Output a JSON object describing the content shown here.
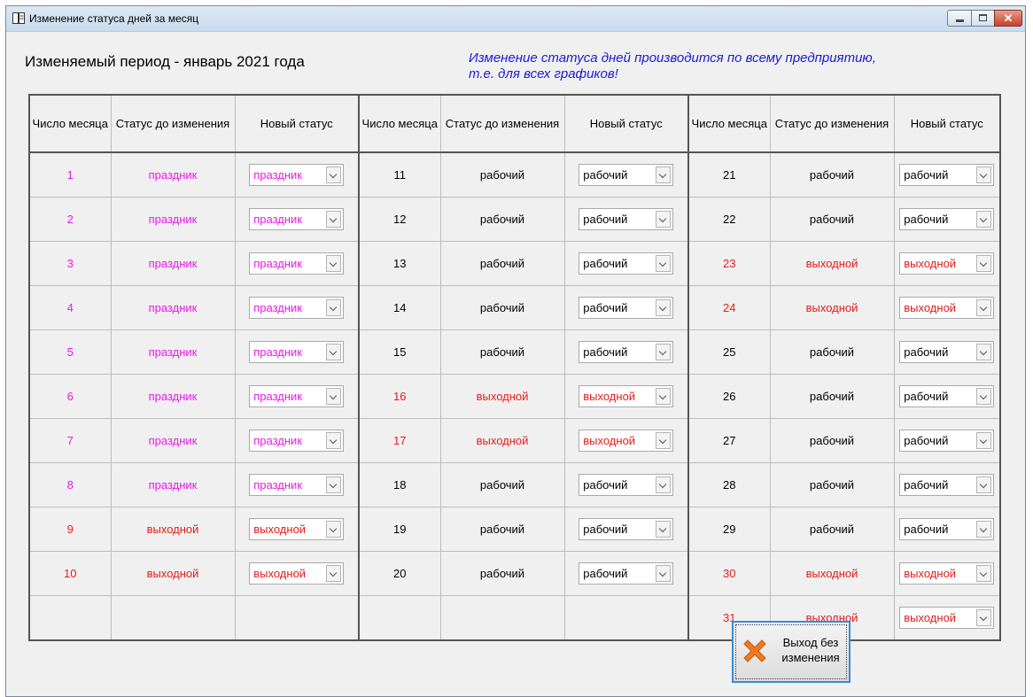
{
  "window": {
    "title": "Изменение статуса дней за месяц"
  },
  "period_label": "Изменяемый период - январь 2021 года",
  "notice_line1": "Изменение статуса дней производится по всему предприятию,",
  "notice_line2": "т.е. для всех графиков!",
  "headers": {
    "day": "Число месяца",
    "status_before": "Статус до изменения",
    "new_status": "Новый статус"
  },
  "colors": {
    "holiday": "#e81ae8",
    "weekend": "#e51c1c",
    "work": "#000000",
    "notice": "#1a1ad4"
  },
  "rows": [
    [
      {
        "day": "1",
        "status": "праздник",
        "new": "праздник",
        "kind": "p"
      },
      {
        "day": "11",
        "status": "рабочий",
        "new": "рабочий",
        "kind": "w"
      },
      {
        "day": "21",
        "status": "рабочий",
        "new": "рабочий",
        "kind": "w"
      }
    ],
    [
      {
        "day": "2",
        "status": "праздник",
        "new": "праздник",
        "kind": "p"
      },
      {
        "day": "12",
        "status": "рабочий",
        "new": "рабочий",
        "kind": "w"
      },
      {
        "day": "22",
        "status": "рабочий",
        "new": "рабочий",
        "kind": "w"
      }
    ],
    [
      {
        "day": "3",
        "status": "праздник",
        "new": "праздник",
        "kind": "p"
      },
      {
        "day": "13",
        "status": "рабочий",
        "new": "рабочий",
        "kind": "w"
      },
      {
        "day": "23",
        "status": "выходной",
        "new": "выходной",
        "kind": "v"
      }
    ],
    [
      {
        "day": "4",
        "status": "праздник",
        "new": "праздник",
        "kind": "p"
      },
      {
        "day": "14",
        "status": "рабочий",
        "new": "рабочий",
        "kind": "w"
      },
      {
        "day": "24",
        "status": "выходной",
        "new": "выходной",
        "kind": "v"
      }
    ],
    [
      {
        "day": "5",
        "status": "праздник",
        "new": "праздник",
        "kind": "p"
      },
      {
        "day": "15",
        "status": "рабочий",
        "new": "рабочий",
        "kind": "w"
      },
      {
        "day": "25",
        "status": "рабочий",
        "new": "рабочий",
        "kind": "w"
      }
    ],
    [
      {
        "day": "6",
        "status": "праздник",
        "new": "праздник",
        "kind": "p"
      },
      {
        "day": "16",
        "status": "выходной",
        "new": "выходной",
        "kind": "v"
      },
      {
        "day": "26",
        "status": "рабочий",
        "new": "рабочий",
        "kind": "w"
      }
    ],
    [
      {
        "day": "7",
        "status": "праздник",
        "new": "праздник",
        "kind": "p"
      },
      {
        "day": "17",
        "status": "выходной",
        "new": "выходной",
        "kind": "v"
      },
      {
        "day": "27",
        "status": "рабочий",
        "new": "рабочий",
        "kind": "w"
      }
    ],
    [
      {
        "day": "8",
        "status": "праздник",
        "new": "праздник",
        "kind": "p"
      },
      {
        "day": "18",
        "status": "рабочий",
        "new": "рабочий",
        "kind": "w"
      },
      {
        "day": "28",
        "status": "рабочий",
        "new": "рабочий",
        "kind": "w"
      }
    ],
    [
      {
        "day": "9",
        "status": "выходной",
        "new": "выходной",
        "kind": "v"
      },
      {
        "day": "19",
        "status": "рабочий",
        "new": "рабочий",
        "kind": "w"
      },
      {
        "day": "29",
        "status": "рабочий",
        "new": "рабочий",
        "kind": "w"
      }
    ],
    [
      {
        "day": "10",
        "status": "выходной",
        "new": "выходной",
        "kind": "v"
      },
      {
        "day": "20",
        "status": "рабочий",
        "new": "рабочий",
        "kind": "w"
      },
      {
        "day": "30",
        "status": "выходной",
        "new": "выходной",
        "kind": "v"
      }
    ],
    [
      null,
      null,
      {
        "day": "31",
        "status": "выходной",
        "new": "выходной",
        "kind": "v"
      }
    ]
  ],
  "exit_button": {
    "line1": "Выход без",
    "line2": "изменения",
    "icon": "close-x-icon"
  }
}
